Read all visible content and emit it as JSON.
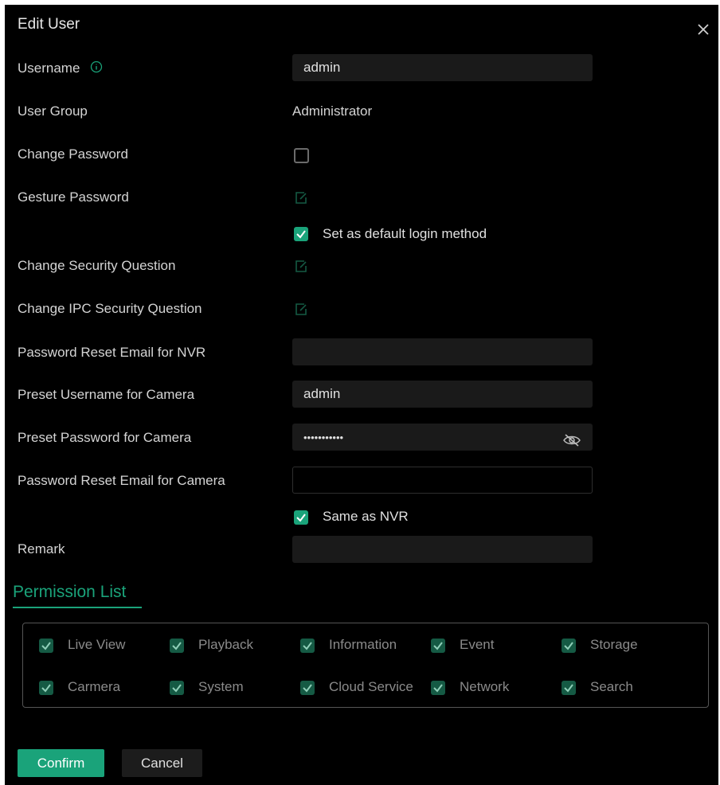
{
  "dialog": {
    "title": "Edit User"
  },
  "fields": {
    "username": {
      "label": "Username",
      "value": "admin"
    },
    "user_group": {
      "label": "User Group",
      "value": "Administrator"
    },
    "change_password": {
      "label": "Change Password",
      "checked": false
    },
    "gesture_password": {
      "label": "Gesture Password"
    },
    "default_login": {
      "label": "Set as default login method",
      "checked": true
    },
    "change_security_question": {
      "label": "Change Security Question"
    },
    "change_ipc_security_question": {
      "label": "Change IPC Security Question"
    },
    "reset_email_nvr": {
      "label": "Password Reset Email for NVR",
      "value": ""
    },
    "preset_username_camera": {
      "label": "Preset Username for Camera",
      "value": "admin"
    },
    "preset_password_camera": {
      "label": "Preset Password for Camera",
      "value": "•••••••••••"
    },
    "reset_email_camera": {
      "label": "Password Reset Email for Camera",
      "value": ""
    },
    "same_as_nvr": {
      "label": "Same as NVR",
      "checked": true
    },
    "remark": {
      "label": "Remark",
      "value": ""
    }
  },
  "permissions": {
    "title": "Permission List",
    "items": [
      {
        "label": "Live View",
        "checked": true
      },
      {
        "label": "Playback",
        "checked": true
      },
      {
        "label": "Information",
        "checked": true
      },
      {
        "label": "Event",
        "checked": true
      },
      {
        "label": "Storage",
        "checked": true
      },
      {
        "label": "Carmera",
        "checked": true
      },
      {
        "label": "System",
        "checked": true
      },
      {
        "label": "Cloud Service",
        "checked": true
      },
      {
        "label": "Network",
        "checked": true
      },
      {
        "label": "Search",
        "checked": true
      }
    ]
  },
  "buttons": {
    "confirm": "Confirm",
    "cancel": "Cancel"
  },
  "colors": {
    "accent": "#1aa37a",
    "background": "#000000",
    "input_bg": "#1a1a1a"
  },
  "icons": {
    "close": "close-icon",
    "info": "info-icon",
    "edit": "edit-icon",
    "eye_off": "eye-off-icon",
    "check": "check-icon"
  }
}
